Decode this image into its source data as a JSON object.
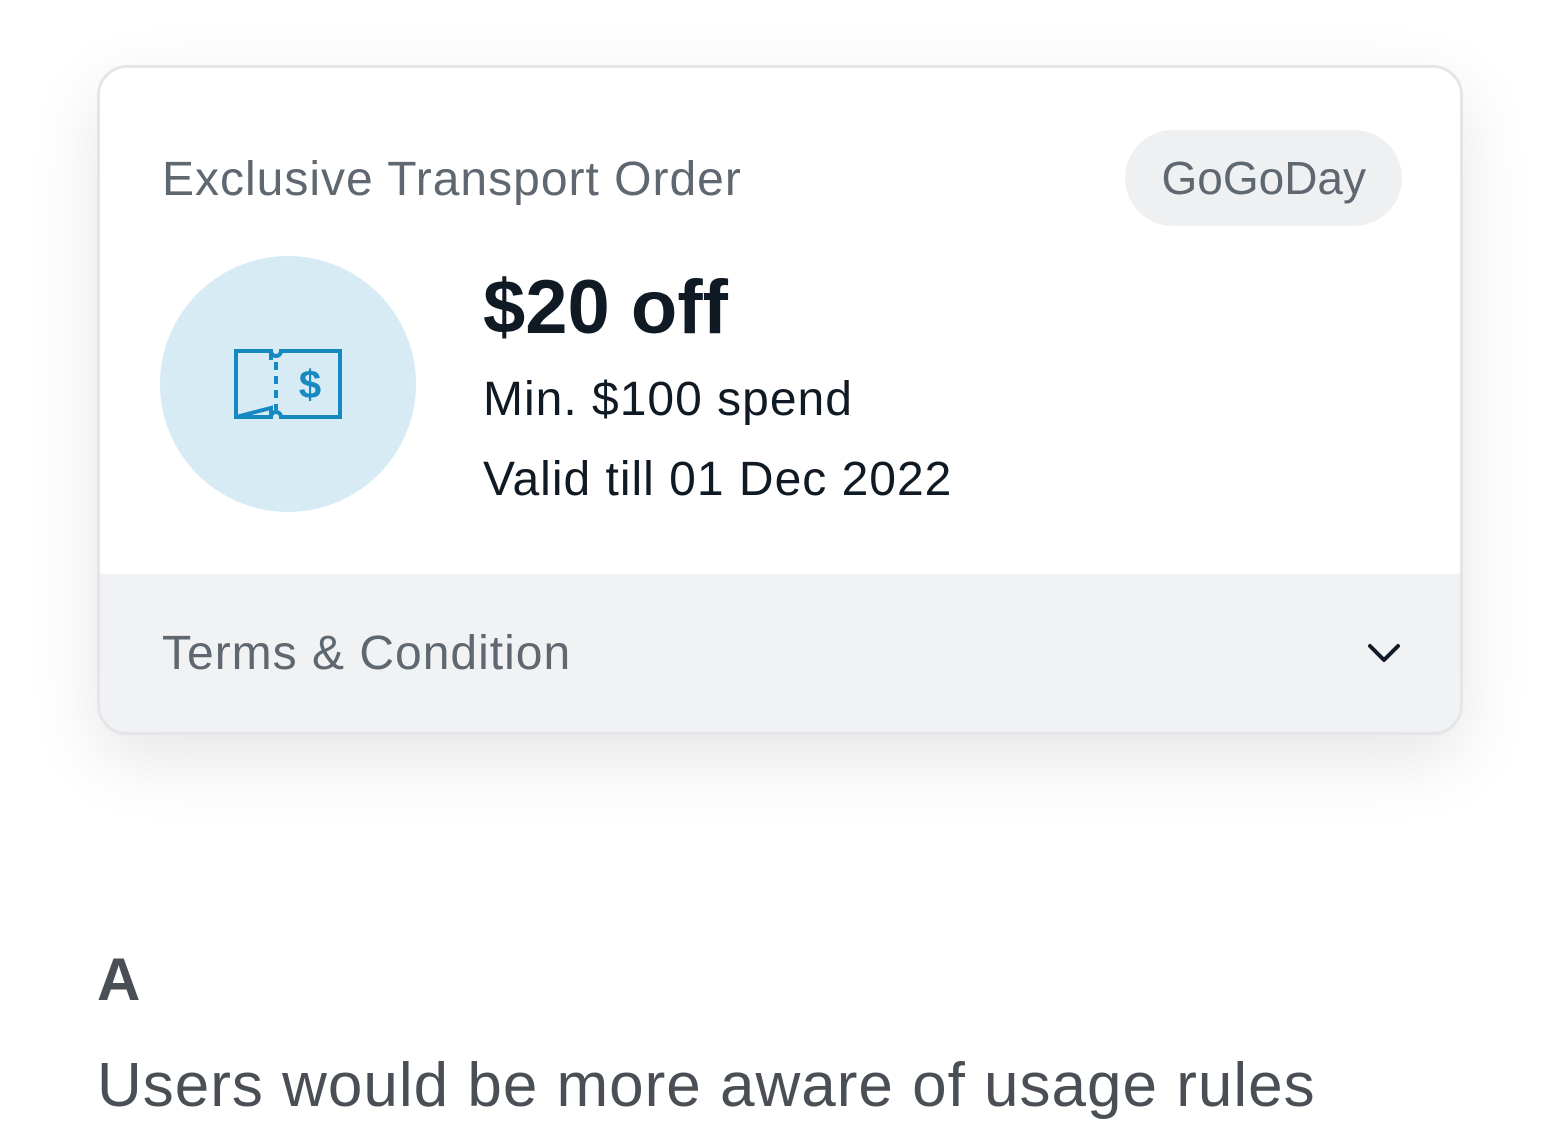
{
  "voucher": {
    "category": "Exclusive Transport Order",
    "merchant": "GoGoDay",
    "icon": "ticket-dollar-icon",
    "offer": "$20 off",
    "min_spend": "Min. $100 spend",
    "validity": "Valid till 01 Dec 2022",
    "terms_label": "Terms & Condition"
  },
  "option": {
    "letter": "A",
    "description": "Users would be more aware of usage rules"
  },
  "colors": {
    "accent_icon": "#1688c2",
    "icon_bg": "#d6ebf4",
    "badge_bg": "#eef0f2",
    "terms_bg": "#f0f2f4",
    "text_primary": "#0f1a24",
    "text_muted": "#5f6870"
  }
}
